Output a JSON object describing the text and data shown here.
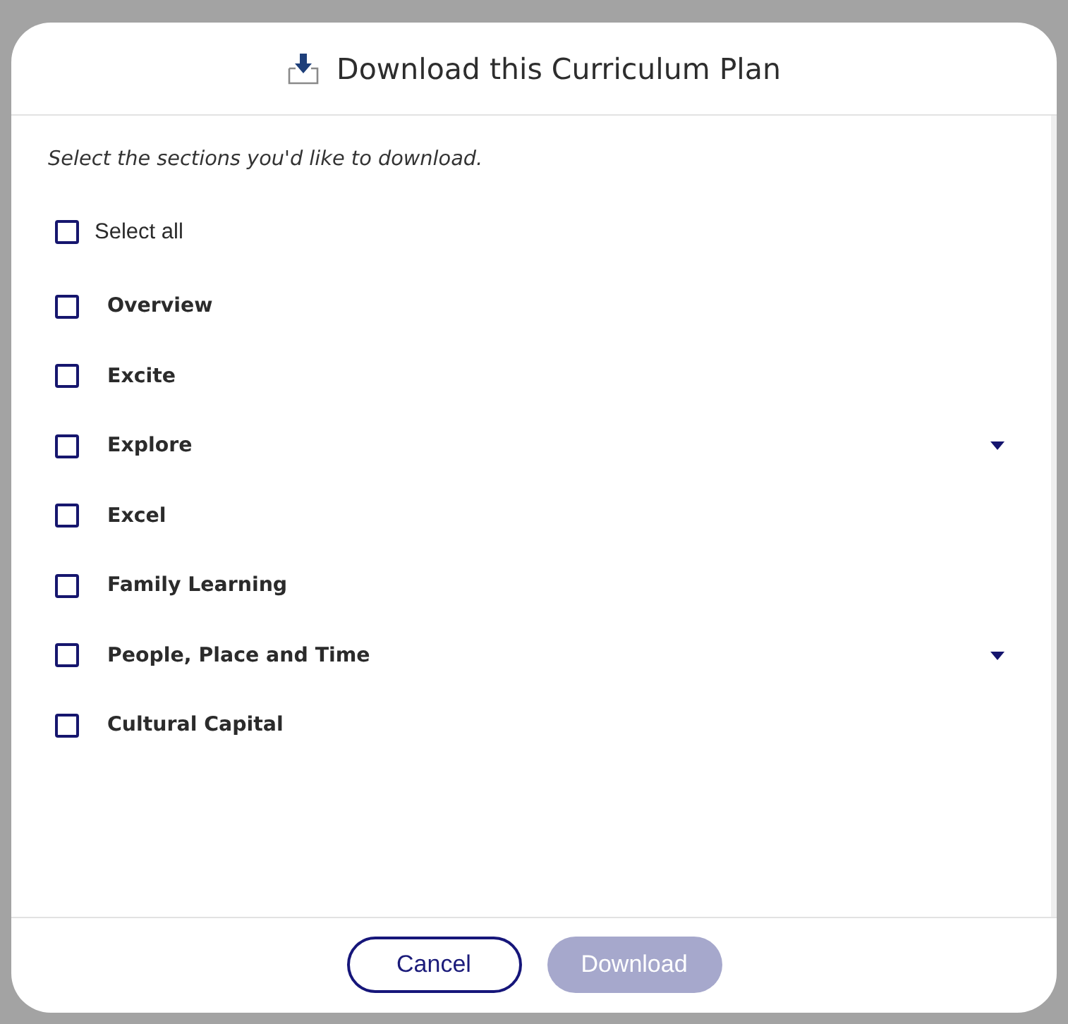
{
  "dialog": {
    "title": "Download this Curriculum Plan",
    "instruction": "Select the sections you'd like to download.",
    "select_all": {
      "label": "Select all",
      "checked": false
    },
    "sections": [
      {
        "label": "Overview",
        "checked": false
      },
      {
        "label": "Excite",
        "checked": false
      },
      {
        "label": "Explore",
        "checked": false,
        "expanded": false
      },
      {
        "label": "Excel",
        "checked": false
      },
      {
        "label": "Family Learning",
        "checked": false
      },
      {
        "label": "People, Place and Time",
        "checked": false,
        "expanded": false
      },
      {
        "label": "Cultural Capital",
        "checked": false
      }
    ],
    "buttons": [
      {
        "label": "Cancel",
        "kind": "secondary",
        "disabled": false
      },
      {
        "label": "Download",
        "kind": "primary",
        "disabled": true
      }
    ]
  }
}
